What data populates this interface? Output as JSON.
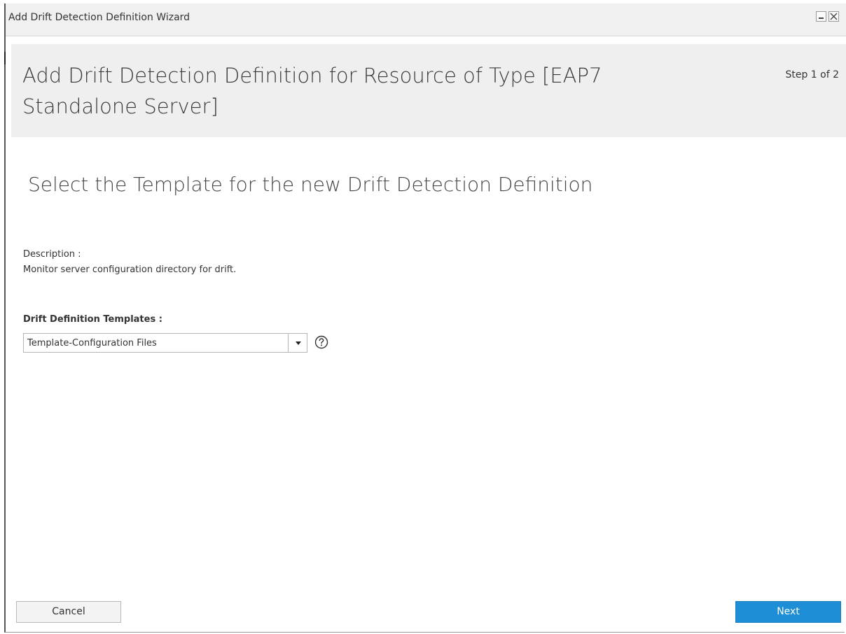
{
  "window": {
    "title": "Add Drift Detection Definition Wizard",
    "minimize_label": "minimize",
    "close_label": "close"
  },
  "header": {
    "title": "Add Drift Detection Definition for Resource of Type [EAP7 Standalone Server]",
    "step": "Step 1 of 2"
  },
  "main": {
    "section_title": "Select the Template for the new Drift Detection Definition",
    "description_label": "Description :",
    "description_value": "Monitor server configuration directory for drift.",
    "templates_label": "Drift Definition Templates :",
    "templates_selected": "Template-Configuration Files"
  },
  "footer": {
    "cancel_label": "Cancel",
    "next_label": "Next"
  },
  "colors": {
    "primary": "#1e8fd6",
    "header_bg": "#efefef",
    "titlebar_bg": "#f0f0f0"
  },
  "icons": {
    "dropdown": "chevron-down-icon",
    "help": "help-icon",
    "minimize": "minimize-icon",
    "close": "close-icon"
  }
}
